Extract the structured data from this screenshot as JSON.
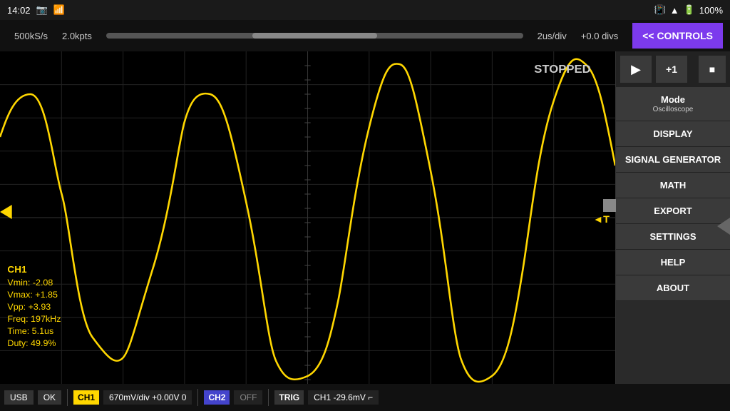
{
  "statusBar": {
    "time": "14:02",
    "battery": "100%"
  },
  "topBar": {
    "sampleRate": "500kS/s",
    "bufferSize": "2.0kpts",
    "timeDiv": "2us/div",
    "offset": "+0.0 divs"
  },
  "controlsBtn": "<< CONTROLS",
  "scopeArea": {
    "stoppedLabel": "STOPPED",
    "channelInfo": {
      "name": "CH1",
      "vmin": "Vmin: -2.08",
      "vmax": "Vmax: +1.85",
      "vpp": "Vpp: +3.93",
      "freq": "Freq: 197kHz",
      "time": "Time: 5.1us",
      "duty": "Duty: 49.9%"
    }
  },
  "rightPanel": {
    "playBtn": "▶",
    "plusOneBtn": "+1",
    "stopBtn": "■",
    "menuItems": [
      {
        "label": "Mode",
        "sub": "Oscilloscope"
      },
      {
        "label": "DISPLAY",
        "sub": ""
      },
      {
        "label": "SIGNAL\nGENERATOR",
        "sub": ""
      },
      {
        "label": "MATH",
        "sub": ""
      },
      {
        "label": "EXPORT",
        "sub": ""
      },
      {
        "label": "SETTINGS",
        "sub": ""
      },
      {
        "label": "HELP",
        "sub": ""
      },
      {
        "label": "ABOUT",
        "sub": ""
      }
    ]
  },
  "bottomBar": {
    "usb": "USB",
    "ok": "OK",
    "ch1Label": "CH1",
    "ch1Info": "670mV/div  +0.00V  0",
    "ch2Label": "CH2",
    "ch2Info": "OFF",
    "trigLabel": "TRIG",
    "trigInfo": "CH1  -29.6mV  ⌐"
  }
}
